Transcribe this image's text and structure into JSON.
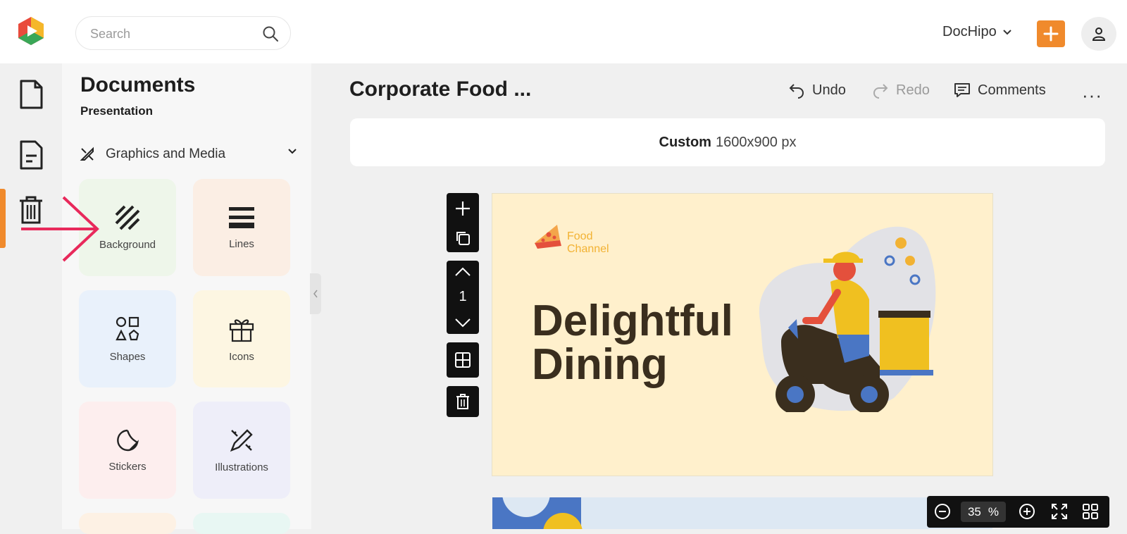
{
  "header": {
    "search_placeholder": "Search",
    "account_name": "DocHipo",
    "add_icon": "plus-icon",
    "user_icon": "user-icon"
  },
  "rail": {
    "items": [
      {
        "icon": "document-icon"
      },
      {
        "icon": "presentation-doc-icon",
        "active": true
      },
      {
        "icon": "trash-icon"
      }
    ]
  },
  "panel": {
    "title": "Documents",
    "subtitle": "Presentation",
    "section": "Graphics and Media",
    "tiles": [
      {
        "label": "Background",
        "icon": "stripes-icon",
        "color": "#eef6ea"
      },
      {
        "label": "Lines",
        "icon": "lines-icon",
        "color": "#fbeee4"
      },
      {
        "label": "Shapes",
        "icon": "shapes-icon",
        "color": "#e9f1fb"
      },
      {
        "label": "Icons",
        "icon": "gift-icon",
        "color": "#fdf6e2"
      },
      {
        "label": "Stickers",
        "icon": "sticker-icon",
        "color": "#fdeeee"
      },
      {
        "label": "Illustrations",
        "icon": "pen-ruler-icon",
        "color": "#eeeef9"
      }
    ]
  },
  "editor": {
    "doc_title": "Corporate Food ...",
    "undo_label": "Undo",
    "redo_label": "Redo",
    "comments_label": "Comments",
    "more_label": "···",
    "size_label": "Custom",
    "size_value": "1600x900 px",
    "page_number": "1"
  },
  "slide": {
    "brand_line1": "Food",
    "brand_line2": "Channel",
    "headline_line1": "Delightful",
    "headline_line2": "Dining"
  },
  "zoom": {
    "value": "35",
    "unit": "%"
  },
  "colors": {
    "accent": "#f08a2c",
    "annotation_arrow": "#e8295b",
    "slide_bg": "#fff0cc"
  }
}
